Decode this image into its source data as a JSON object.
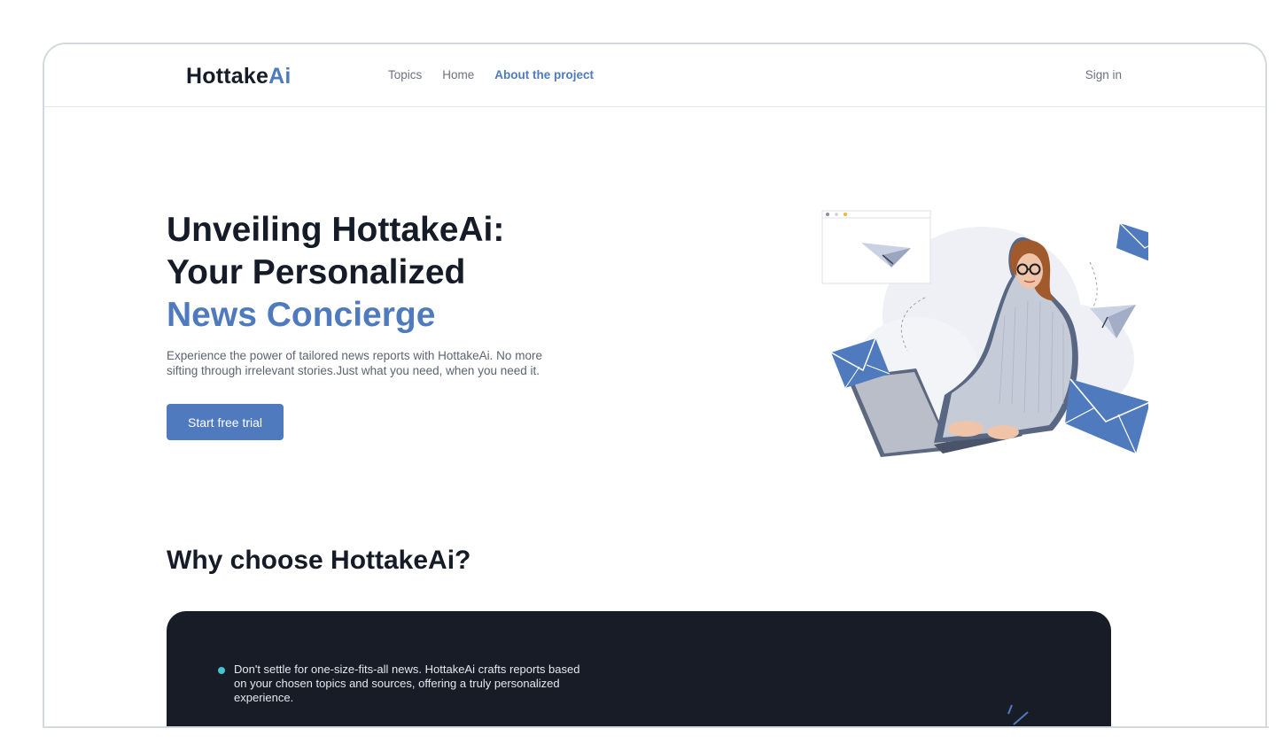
{
  "brand": {
    "name_main": "Hottake",
    "name_accent": "Ai"
  },
  "nav": {
    "links": [
      {
        "label": "Topics",
        "active": false
      },
      {
        "label": "Home",
        "active": false
      },
      {
        "label": "About the project",
        "active": true
      }
    ],
    "signin_label": "Sign in"
  },
  "hero": {
    "title_line1": "Unveiling HottakeAi:",
    "title_line2": "Your Personalized",
    "title_line3": "News Concierge",
    "description": "Experience the power of tailored news reports with HottakeAi. No more sifting through irrelevant stories.Just what you need, when you need it.",
    "cta_label": "Start free trial"
  },
  "why": {
    "title": "Why choose HottakeAi?",
    "features": [
      {
        "text": "Don't settle for one-size-fits-all news. HottakeAi crafts reports based on your chosen topics and sources, offering a truly personalized experience."
      }
    ]
  },
  "colors": {
    "accent": "#4f7bbe",
    "dark": "#151b27",
    "bullet": "#45c3d2",
    "card_bg": "#171c27"
  },
  "icons": [
    "paper-plane-icon",
    "envelope-icon",
    "browser-window-icon"
  ]
}
